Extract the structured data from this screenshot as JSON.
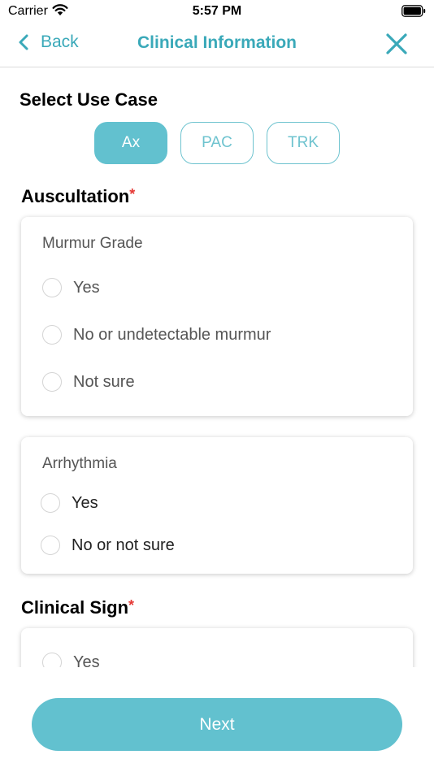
{
  "status_bar": {
    "carrier": "Carrier",
    "time": "5:57 PM"
  },
  "nav": {
    "back_label": "Back",
    "title": "Clinical Information"
  },
  "use_case": {
    "title": "Select Use Case",
    "options": [
      "Ax",
      "PAC",
      "TRK"
    ],
    "selected": "Ax"
  },
  "auscultation": {
    "title": "Auscultation",
    "required_mark": "*",
    "murmur": {
      "label": "Murmur Grade",
      "options": [
        "Yes",
        "No or undetectable murmur",
        "Not sure"
      ]
    },
    "arrhythmia": {
      "label": "Arrhythmia",
      "options": [
        "Yes",
        "No or not sure"
      ]
    }
  },
  "clinical_sign": {
    "title": "Clinical Sign",
    "required_mark": "*",
    "options": [
      "Yes"
    ]
  },
  "footer": {
    "next_label": "Next"
  },
  "colors": {
    "accent": "#3aa9b9",
    "button": "#62c1cf",
    "required": "#e53935"
  }
}
